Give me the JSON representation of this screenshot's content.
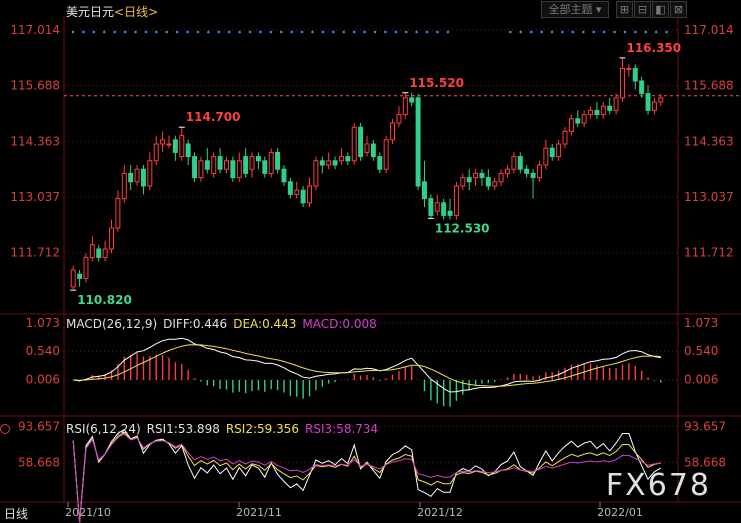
{
  "header": {
    "instrument": "美元日元",
    "cycle": "<日线>",
    "dropdown_label": "全部主题",
    "buttons": [
      "⊞",
      "⊟",
      "◧",
      "⊠"
    ],
    "corner_price": "117.014"
  },
  "watermark": "FX678",
  "bottom_tab": "日线",
  "colors": {
    "up": "#ff3d3d",
    "down": "#2fd08c",
    "grid": "#6e1010",
    "axis_text": "#d8403a",
    "dots": "#1e90ff"
  },
  "chart_data": {
    "type": "candlestick",
    "price_axis": {
      "ticks": [
        "117.014",
        "115.688",
        "114.363",
        "113.037",
        "111.712"
      ],
      "min": 110.3,
      "max": 117.3
    },
    "reference_line": 115.45,
    "annotations": [
      {
        "label": "110.820",
        "value": 110.82,
        "type": "low"
      },
      {
        "label": "114.700",
        "value": 114.7,
        "type": "high"
      },
      {
        "label": "115.520",
        "value": 115.52,
        "type": "high"
      },
      {
        "label": "112.530",
        "value": 112.53,
        "type": "low"
      },
      {
        "label": "116.350",
        "value": 116.35,
        "type": "high"
      }
    ],
    "x_labels": [
      "2021/10",
      "2021/11",
      "2021/12",
      "2022/01"
    ],
    "candles": [
      [
        110.9,
        111.3,
        110.82,
        111.4
      ],
      [
        111.2,
        111.1,
        110.9,
        111.3
      ],
      [
        111.1,
        111.6,
        111.0,
        111.7
      ],
      [
        111.6,
        111.9,
        111.5,
        112.1
      ],
      [
        111.8,
        111.6,
        111.5,
        111.9
      ],
      [
        111.6,
        111.8,
        111.5,
        112.0
      ],
      [
        111.8,
        112.3,
        111.7,
        112.5
      ],
      [
        112.3,
        113.0,
        112.2,
        113.2
      ],
      [
        113.0,
        113.6,
        112.9,
        113.8
      ],
      [
        113.6,
        113.4,
        113.2,
        113.8
      ],
      [
        113.4,
        113.7,
        113.3,
        113.8
      ],
      [
        113.7,
        113.3,
        113.1,
        113.8
      ],
      [
        113.3,
        113.9,
        113.2,
        114.1
      ],
      [
        113.9,
        114.3,
        113.8,
        114.5
      ],
      [
        114.3,
        114.4,
        114.1,
        114.6
      ],
      [
        114.3,
        114.3,
        114.2,
        114.5
      ],
      [
        114.4,
        114.1,
        113.9,
        114.5
      ],
      [
        114.0,
        114.5,
        113.9,
        114.7
      ],
      [
        114.3,
        114.0,
        113.8,
        114.4
      ],
      [
        114.0,
        113.5,
        113.4,
        114.1
      ],
      [
        113.5,
        113.9,
        113.4,
        114.0
      ],
      [
        113.9,
        113.7,
        113.6,
        114.2
      ],
      [
        113.6,
        114.0,
        113.5,
        114.1
      ],
      [
        114.0,
        113.7,
        113.6,
        114.2
      ],
      [
        113.7,
        113.9,
        113.6,
        114.0
      ],
      [
        113.9,
        113.5,
        113.4,
        114.0
      ],
      [
        113.5,
        113.9,
        113.4,
        114.1
      ],
      [
        114.0,
        113.6,
        113.5,
        114.2
      ],
      [
        113.7,
        114.0,
        113.5,
        114.1
      ],
      [
        114.0,
        113.9,
        113.7,
        114.1
      ],
      [
        113.9,
        113.6,
        113.5,
        114.0
      ],
      [
        113.6,
        114.1,
        113.5,
        114.2
      ],
      [
        114.1,
        113.7,
        113.6,
        114.2
      ],
      [
        113.7,
        113.4,
        113.3,
        113.8
      ],
      [
        113.4,
        113.1,
        113.0,
        113.5
      ],
      [
        113.1,
        113.2,
        113.0,
        113.4
      ],
      [
        113.2,
        112.9,
        112.8,
        113.3
      ],
      [
        112.9,
        113.3,
        112.8,
        113.5
      ],
      [
        113.3,
        113.9,
        113.2,
        114.0
      ],
      [
        113.9,
        113.8,
        113.6,
        114.0
      ],
      [
        113.8,
        113.9,
        113.7,
        114.1
      ],
      [
        113.9,
        113.8,
        113.7,
        114.0
      ],
      [
        113.9,
        114.0,
        113.8,
        114.2
      ],
      [
        114.0,
        113.9,
        113.8,
        114.1
      ],
      [
        113.9,
        114.7,
        113.8,
        114.8
      ],
      [
        114.7,
        114.0,
        113.9,
        114.8
      ],
      [
        114.1,
        114.3,
        114.0,
        114.5
      ],
      [
        114.3,
        114.0,
        113.9,
        114.4
      ],
      [
        114.0,
        113.7,
        113.6,
        114.1
      ],
      [
        113.7,
        114.4,
        113.6,
        114.5
      ],
      [
        114.4,
        114.8,
        114.3,
        114.9
      ],
      [
        114.8,
        115.0,
        114.7,
        115.2
      ],
      [
        115.0,
        115.4,
        114.9,
        115.52
      ],
      [
        115.4,
        115.3,
        115.2,
        115.52
      ],
      [
        115.4,
        113.3,
        113.2,
        115.5
      ],
      [
        113.4,
        113.0,
        112.8,
        113.9
      ],
      [
        113.0,
        112.6,
        112.53,
        113.1
      ],
      [
        112.7,
        112.9,
        112.6,
        113.1
      ],
      [
        112.9,
        112.6,
        112.5,
        113.0
      ],
      [
        112.7,
        112.6,
        112.5,
        113.0
      ],
      [
        112.6,
        113.3,
        112.5,
        113.4
      ],
      [
        113.3,
        113.5,
        113.2,
        113.6
      ],
      [
        113.5,
        113.4,
        113.2,
        113.7
      ],
      [
        113.5,
        113.6,
        113.3,
        113.7
      ],
      [
        113.6,
        113.5,
        113.3,
        113.7
      ],
      [
        113.5,
        113.3,
        113.2,
        113.7
      ],
      [
        113.3,
        113.4,
        113.2,
        113.5
      ],
      [
        113.4,
        113.6,
        113.3,
        113.7
      ],
      [
        113.6,
        113.7,
        113.5,
        113.8
      ],
      [
        113.7,
        114.0,
        113.6,
        114.1
      ],
      [
        114.0,
        113.7,
        113.6,
        114.1
      ],
      [
        113.7,
        113.6,
        113.5,
        113.8
      ],
      [
        113.6,
        113.5,
        113.0,
        113.7
      ],
      [
        113.5,
        113.8,
        113.4,
        113.9
      ],
      [
        113.8,
        114.2,
        113.7,
        114.4
      ],
      [
        114.2,
        114.0,
        113.9,
        114.3
      ],
      [
        114.0,
        114.3,
        113.9,
        114.4
      ],
      [
        114.3,
        114.6,
        114.2,
        114.7
      ],
      [
        114.6,
        114.9,
        114.5,
        115.0
      ],
      [
        114.9,
        114.8,
        114.7,
        115.1
      ],
      [
        114.8,
        115.0,
        114.7,
        115.1
      ],
      [
        115.0,
        115.1,
        114.9,
        115.2
      ],
      [
        115.1,
        115.0,
        114.9,
        115.3
      ],
      [
        115.0,
        115.2,
        114.9,
        115.3
      ],
      [
        115.2,
        115.1,
        115.0,
        115.4
      ],
      [
        115.1,
        115.4,
        115.0,
        115.5
      ],
      [
        115.4,
        116.1,
        115.3,
        116.35
      ],
      [
        116.1,
        116.1,
        115.9,
        116.2
      ],
      [
        116.1,
        115.8,
        115.6,
        116.2
      ],
      [
        115.8,
        115.5,
        115.4,
        115.9
      ],
      [
        115.5,
        115.1,
        115.0,
        115.7
      ],
      [
        115.1,
        115.3,
        115.0,
        115.4
      ],
      [
        115.3,
        115.4,
        115.2,
        115.5
      ]
    ],
    "dot_row_count": 58,
    "macd": {
      "label": "MACD(26,12,9)",
      "diff_label": "DIFF:0.446",
      "dea_label": "DEA:0.443",
      "macd_label": "MACD:0.008",
      "ticks": [
        "1.073",
        "0.540",
        "0.006"
      ],
      "min": -0.6,
      "max": 1.2,
      "diff_color": "#ffffff",
      "dea_color": "#f0e050",
      "macd_color": "#d040d0"
    },
    "rsi": {
      "label": "RSI(6,12,24)",
      "rsi1_label": "RSI1:53.898",
      "rsi2_label": "RSI2:59.356",
      "rsi3_label": "RSI3:58.734",
      "ticks": [
        "93.657",
        "58.668"
      ],
      "min": 20,
      "max": 100,
      "rsi1_color": "#ffffff",
      "rsi2_color": "#f0e050",
      "rsi3_color": "#d040d0"
    }
  }
}
